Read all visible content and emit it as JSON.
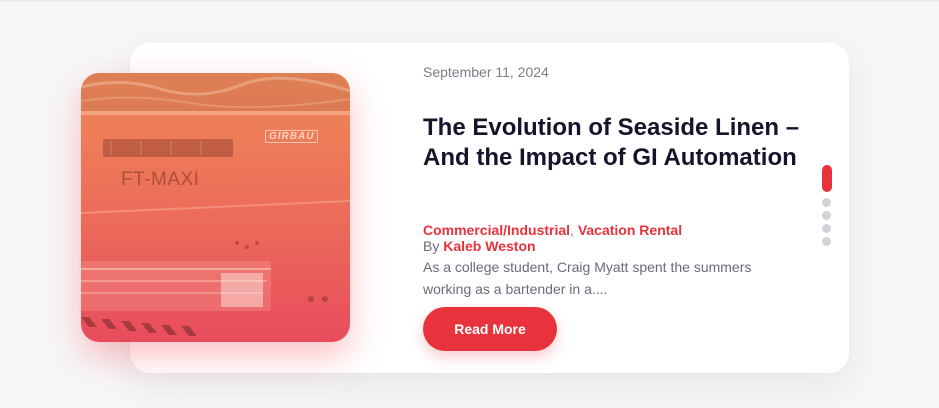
{
  "post": {
    "date": "September 11, 2024",
    "title": "The Evolution of Seaside Linen – And the Impact of GI Automation",
    "categories": [
      "Commercial/Industrial",
      "Vacation Rental"
    ],
    "category_separator": ", ",
    "by_label": "By",
    "author": "Kaleb Weston",
    "excerpt": "As a college student, Craig Myatt spent the summers working as a bartender in a....",
    "read_more_label": "Read More",
    "image": {
      "machine_label": "FT-MAXI",
      "brand_label": "GIRBAU"
    }
  },
  "slider": {
    "total_slides": 5,
    "active_index": 0
  },
  "colors": {
    "accent": "#e8323c",
    "title": "#15142b",
    "muted": "#7d7d8a",
    "dot_inactive": "#d2d2d8"
  }
}
